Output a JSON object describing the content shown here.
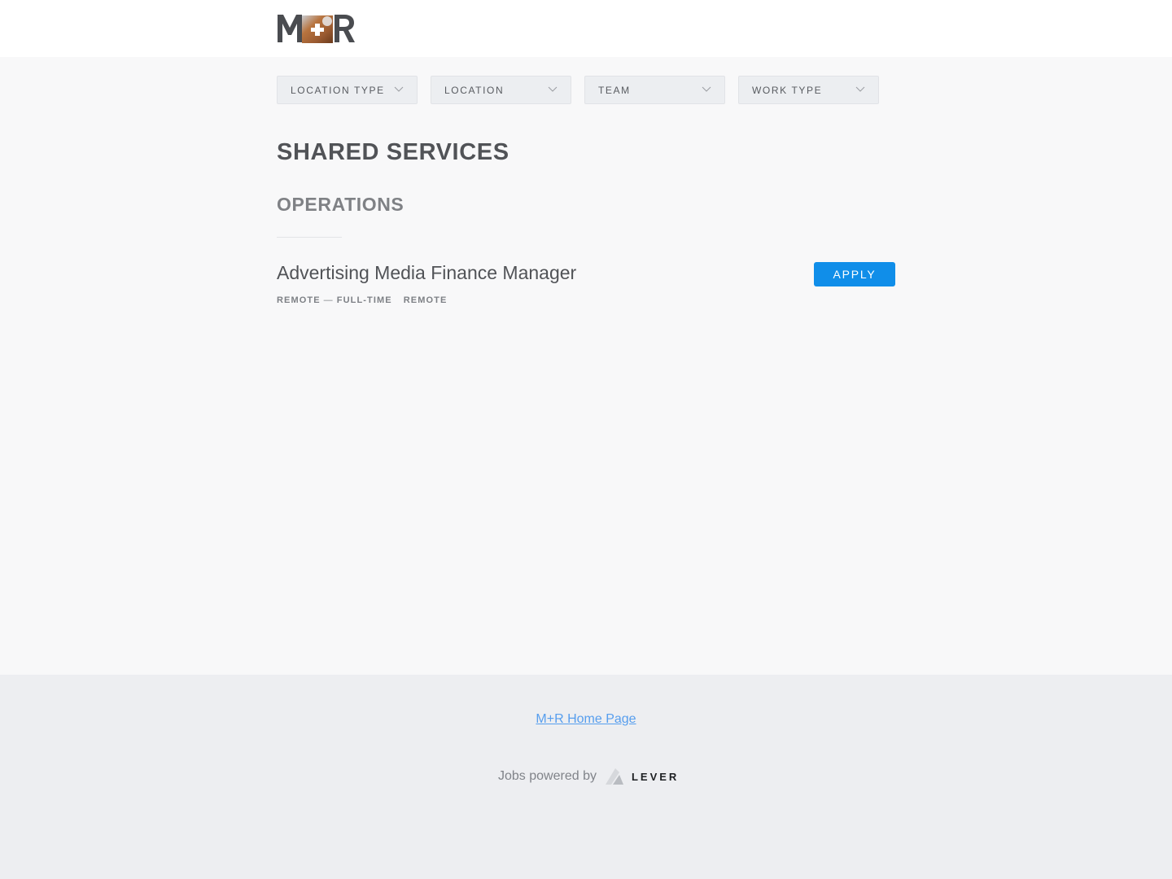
{
  "header": {
    "logo_text": "M+R"
  },
  "filters": [
    {
      "label": "LOCATION TYPE"
    },
    {
      "label": "LOCATION"
    },
    {
      "label": "TEAM"
    },
    {
      "label": "WORK TYPE"
    }
  ],
  "main": {
    "team_title": "SHARED SERVICES",
    "department_title": "OPERATIONS",
    "posting": {
      "title": "Advertising Media Finance Manager",
      "apply_label": "APPLY",
      "commitment_location": "REMOTE",
      "commitment_sep": "—",
      "commitment_type": "FULL-TIME",
      "workplace": "REMOTE"
    }
  },
  "footer": {
    "home_link": "M+R Home Page",
    "powered_by": "Jobs powered by",
    "lever_word": "LEVER"
  },
  "colors": {
    "accent": "#108ee9",
    "link": "#579eee",
    "page_bg": "#f8f8f9",
    "footer_bg": "#edeef1"
  },
  "icons": {
    "filter_chevron": "chevron-down-icon",
    "lever": "lever-logo-icon"
  }
}
